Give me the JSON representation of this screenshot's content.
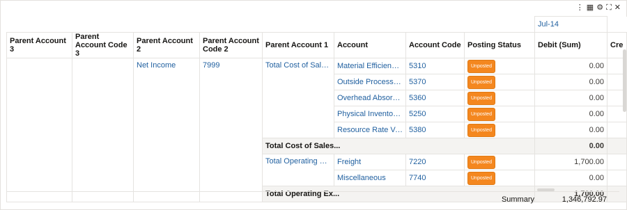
{
  "toolbar": {
    "icons": [
      "more-icon",
      "grid-icon",
      "gear-icon",
      "expand-icon",
      "close-icon"
    ]
  },
  "period": "Jul-14",
  "columns": {
    "pa3": "Parent Account 3",
    "pac3": "Parent Account Code 3",
    "pa2": "Parent Account 2",
    "pac2": "Parent Account Code 2",
    "pa1": "Parent Account 1",
    "account": "Account",
    "code": "Account Code",
    "status": "Posting Status",
    "debit": "Debit (Sum)",
    "credit": "Cre"
  },
  "group": {
    "pa2": "Net Income",
    "pac2": "7999"
  },
  "cost_group": {
    "pa1": "Total Cost of Sales...",
    "subtotal_label": "Total Cost of Sales...",
    "subtotal": "0.00"
  },
  "cost_rows": [
    {
      "account": "Material Efficiency...",
      "code": "5310",
      "status": "Unposted",
      "debit": "0.00"
    },
    {
      "account": "Outside Processin...",
      "code": "5370",
      "status": "Unposted",
      "debit": "0.00"
    },
    {
      "account": "Overhead Absorbt...",
      "code": "5360",
      "status": "Unposted",
      "debit": "0.00"
    },
    {
      "account": "Physical Inventory...",
      "code": "5250",
      "status": "Unposted",
      "debit": "0.00"
    },
    {
      "account": "Resource Rate Var...",
      "code": "5380",
      "status": "Unposted",
      "debit": "0.00"
    }
  ],
  "op_group": {
    "pa1": "Total Operating Ex...",
    "subtotal_label": "Total Operating Ex...",
    "subtotal": "1,700.00"
  },
  "op_rows": [
    {
      "account": "Freight",
      "code": "7220",
      "status": "Unposted",
      "debit": "1,700.00"
    },
    {
      "account": "Miscellaneous",
      "code": "7740",
      "status": "Unposted",
      "debit": "0.00"
    }
  ],
  "summary": {
    "label": "Summary",
    "value": "1,346,792.97"
  }
}
